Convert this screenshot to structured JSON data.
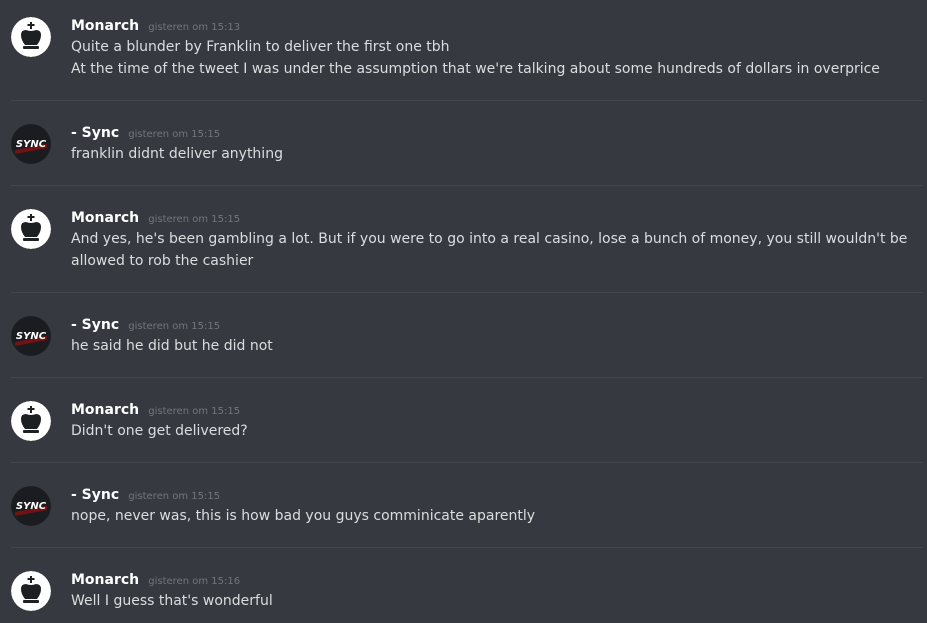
{
  "messages": [
    {
      "author": "Monarch",
      "avatar_icon": "chess-king-icon",
      "timestamp": "gisteren om 15:13",
      "lines": [
        "Quite a blunder by Franklin to deliver the first one tbh",
        "At the time of the tweet I was under the assumption that we're talking about some hundreds of dollars in overprice"
      ]
    },
    {
      "author": "- Sync",
      "avatar_icon": "sync-logo-icon",
      "avatar_text": "SYNC",
      "timestamp": "gisteren om 15:15",
      "lines": [
        "franklin didnt deliver anything"
      ]
    },
    {
      "author": "Monarch",
      "avatar_icon": "chess-king-icon",
      "timestamp": "gisteren om 15:15",
      "lines": [
        "And yes, he's been gambling a lot. But if you were to go into a real casino, lose a bunch of money, you still wouldn't be",
        "allowed to rob the cashier"
      ]
    },
    {
      "author": "- Sync",
      "avatar_icon": "sync-logo-icon",
      "avatar_text": "SYNC",
      "timestamp": "gisteren om 15:15",
      "lines": [
        "he said he did but he did not"
      ]
    },
    {
      "author": "Monarch",
      "avatar_icon": "chess-king-icon",
      "timestamp": "gisteren om 15:15",
      "lines": [
        "Didn't one get delivered?"
      ]
    },
    {
      "author": "- Sync",
      "avatar_icon": "sync-logo-icon",
      "avatar_text": "SYNC",
      "timestamp": "gisteren om 15:15",
      "lines": [
        "nope, never was, this is how bad you guys comminicate aparently"
      ]
    },
    {
      "author": "Monarch",
      "avatar_icon": "chess-king-icon",
      "timestamp": "gisteren om 15:16",
      "lines": [
        "Well I guess that's wonderful"
      ]
    }
  ],
  "colors": {
    "background": "#36393f",
    "author": "#ffffff",
    "timestamp": "#72767d",
    "text": "#dcddde",
    "divider": "#42454a"
  }
}
